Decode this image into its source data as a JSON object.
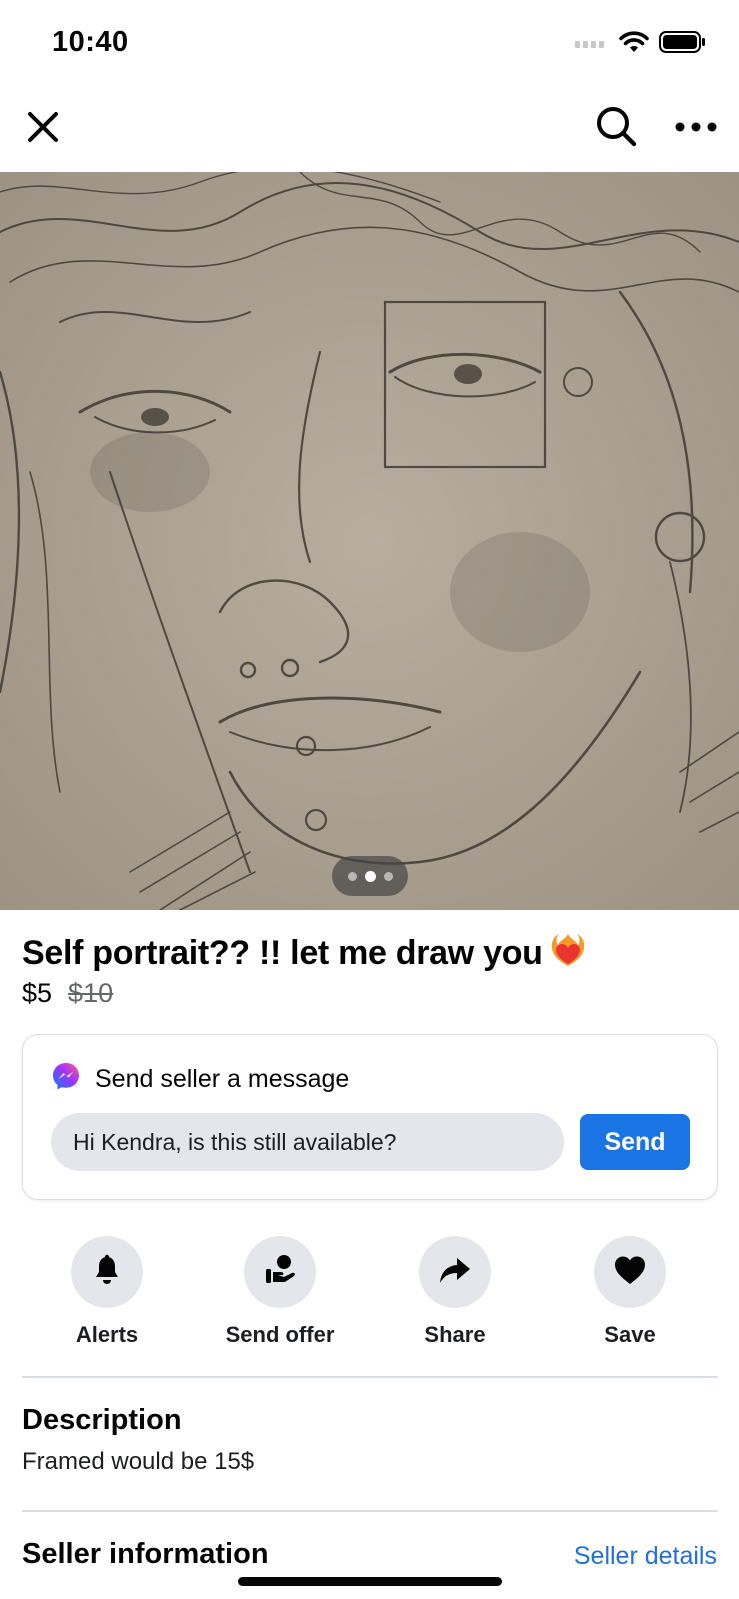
{
  "status_bar": {
    "time": "10:40",
    "icons": [
      "signal-icon",
      "wifi-icon",
      "battery-icon"
    ]
  },
  "nav": {
    "close_icon": "close-icon",
    "search_icon": "search-icon",
    "more_icon": "more-icon"
  },
  "listing": {
    "photo_description_icon": "listing-photo",
    "page_count": 3,
    "active_page": 2,
    "title": "Self portrait?? !! let me draw you",
    "title_emoji_icon": "heart-on-fire-icon",
    "price": "$5",
    "original_price": "$10"
  },
  "message": {
    "heading": "Send seller a message",
    "messenger_icon": "messenger-icon",
    "input_value": "Hi Kendra, is this still available?",
    "send_label": "Send"
  },
  "actions": [
    {
      "label": "Alerts",
      "icon": "bell-icon"
    },
    {
      "label": "Send offer",
      "icon": "offer-icon"
    },
    {
      "label": "Share",
      "icon": "share-icon"
    },
    {
      "label": "Save",
      "icon": "heart-icon"
    }
  ],
  "description": {
    "heading": "Description",
    "body": "Framed would be 15$"
  },
  "seller": {
    "heading": "Seller information",
    "details_link": "Seller details"
  },
  "colors": {
    "accent": "#1b74e4",
    "link": "#216fdb",
    "gray_fill": "#e4e6eb",
    "secondary_text": "#65676b"
  }
}
